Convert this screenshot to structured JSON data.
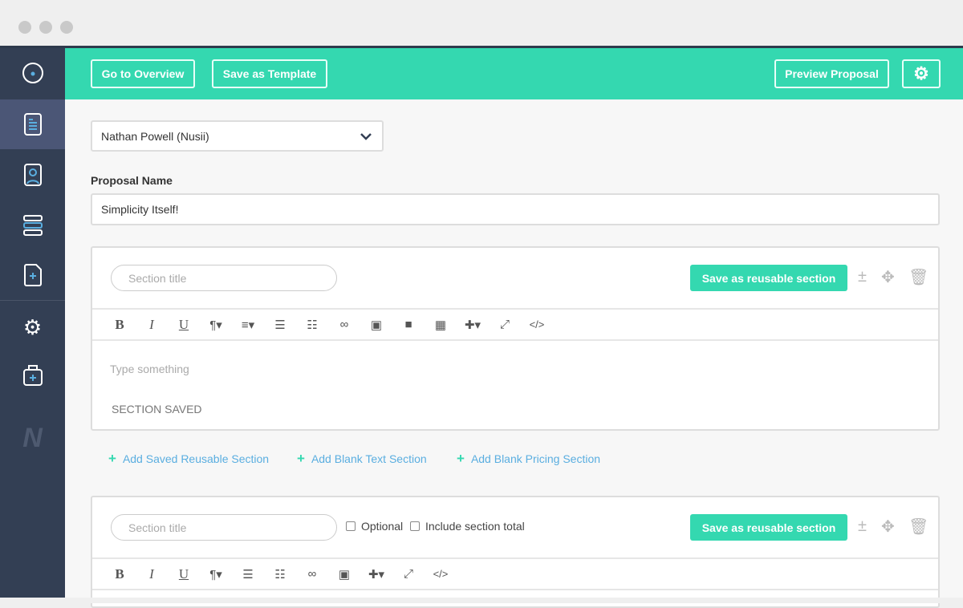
{
  "header": {
    "go_overview": "Go to Overview",
    "save_template": "Save as Template",
    "preview": "Preview Proposal"
  },
  "client_select": {
    "value": "Nathan Powell (Nusii)"
  },
  "proposal_name": {
    "label": "Proposal Name",
    "value": "Simplicity Itself!"
  },
  "sections": [
    {
      "title_placeholder": "Section title",
      "save_label": "Save as reusable section",
      "editor_placeholder": "Type something",
      "saved_text": "SECTION SAVED"
    },
    {
      "title_placeholder": "Section title",
      "save_label": "Save as reusable section",
      "optional_label": "Optional",
      "include_total_label": "Include section total"
    }
  ],
  "add_links": [
    "Add Saved Reusable Section",
    "Add Blank Text Section",
    "Add Blank Pricing Section"
  ],
  "colors": {
    "accent": "#34d8b0",
    "sidebar": "#333f54",
    "link": "#5aaee0"
  },
  "logo": "N"
}
